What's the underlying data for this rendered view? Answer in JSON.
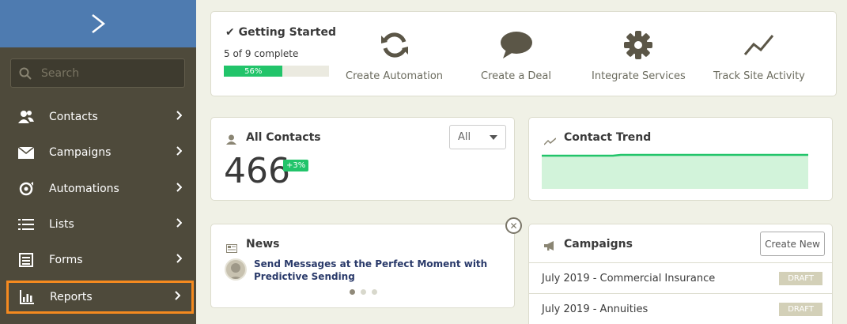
{
  "sidebar": {
    "search_placeholder": "Search",
    "items": [
      {
        "label": "Contacts",
        "icon": "contacts-icon"
      },
      {
        "label": "Campaigns",
        "icon": "envelope-icon"
      },
      {
        "label": "Automations",
        "icon": "automations-icon"
      },
      {
        "label": "Lists",
        "icon": "list-icon"
      },
      {
        "label": "Forms",
        "icon": "form-icon"
      },
      {
        "label": "Reports",
        "icon": "bar-chart-icon",
        "active": true
      }
    ]
  },
  "getting_started": {
    "title": "Getting Started",
    "progress_text": "5 of 9 complete",
    "progress_label": "56%",
    "progress_fraction": 0.56,
    "actions": [
      {
        "label": "Create Automation",
        "icon": "refresh-icon"
      },
      {
        "label": "Create a Deal",
        "icon": "chat-bubble-icon"
      },
      {
        "label": "Integrate Services",
        "icon": "gear-icon"
      },
      {
        "label": "Track Site Activity",
        "icon": "trend-line-icon"
      }
    ]
  },
  "all_contacts": {
    "title": "All Contacts",
    "filter_value": "All",
    "count": "466",
    "delta": "+3%"
  },
  "contact_trend": {
    "title": "Contact Trend"
  },
  "news": {
    "title": "News",
    "headline": "Send Messages at the Perfect Moment with Predictive Sending"
  },
  "campaigns": {
    "title": "Campaigns",
    "create_label": "Create New",
    "rows": [
      {
        "name": "July 2019 - Commercial Insurance",
        "status": "DRAFT"
      },
      {
        "name": "July 2019 - Annuities",
        "status": "DRAFT"
      }
    ]
  },
  "colors": {
    "sidebar": "#4e4a3b",
    "logo_bar": "#4e7bb0",
    "accent_green": "#22c46a",
    "active_outline": "#f58a1f"
  }
}
